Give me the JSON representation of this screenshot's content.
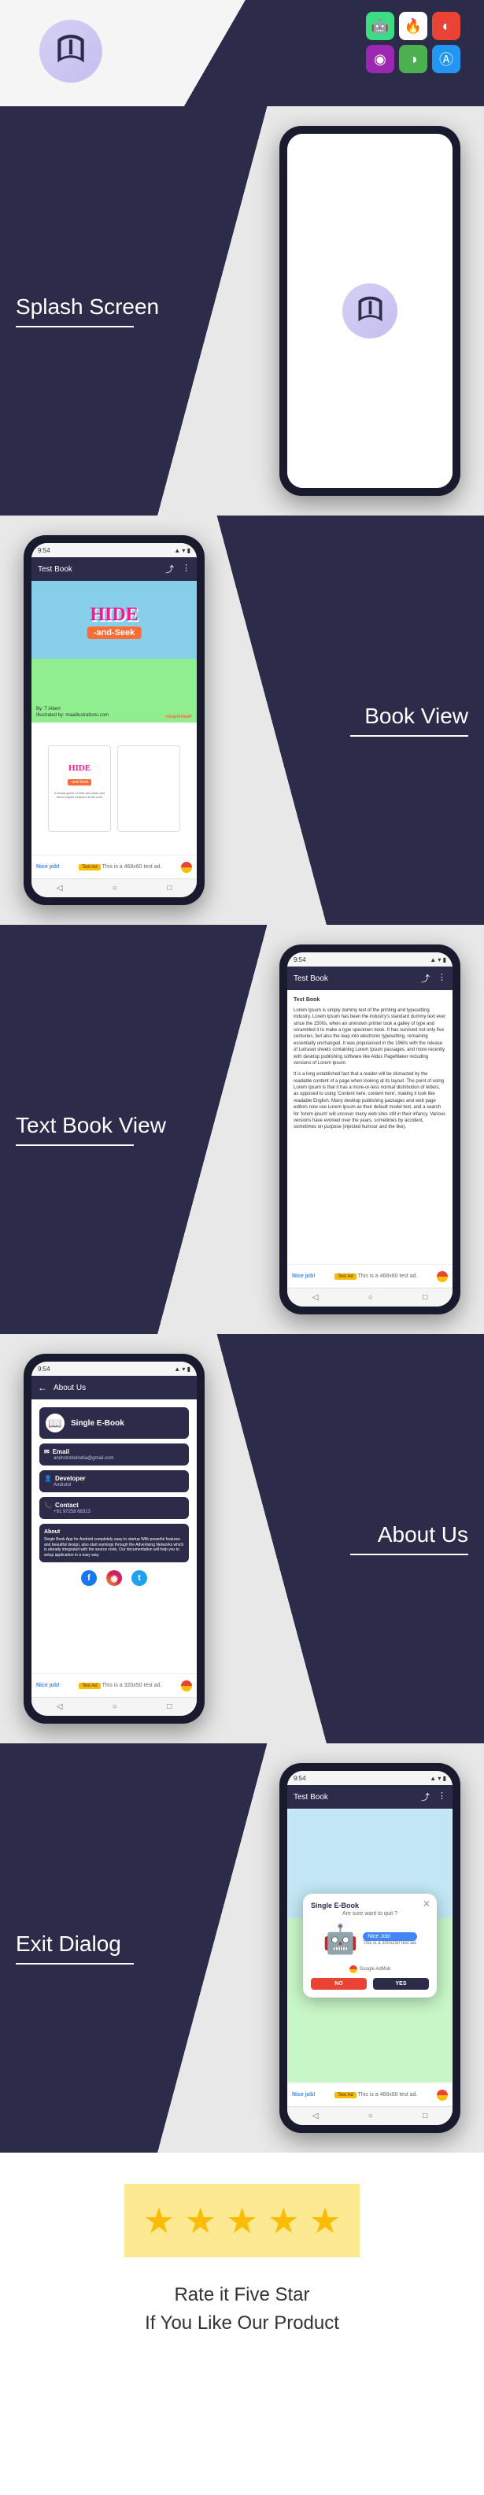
{
  "header": {
    "icons": [
      "android-studio",
      "firebase",
      "admob",
      "unity",
      "playstore",
      "appstore"
    ]
  },
  "sections": {
    "splash": {
      "label": "Splash Screen"
    },
    "bookview": {
      "label": "Book View"
    },
    "textbook": {
      "label": "Text Book View"
    },
    "about": {
      "label": "About Us"
    },
    "exit": {
      "label": "Exit Dialog"
    }
  },
  "phone": {
    "status_time": "9:54",
    "status_icons": "▲ ▾ ▮",
    "app_title": "Test Book",
    "about_title": "About Us",
    "nav": {
      "back": "◁",
      "home": "○",
      "recent": "□"
    }
  },
  "book": {
    "title": "HIDE",
    "subtitle": "-and-Seek",
    "author_line1": "By: T Albert",
    "author_line2": "Illustrated by: maaillustrations.com",
    "badge": "•maple•leaf•",
    "mini_text": "A virtual game of hide-and-seek and there maybe treasure at the end!"
  },
  "textbook": {
    "heading": "Test Book",
    "p1": "Lorem Ipsum is simply dummy text of the printing and typesetting industry. Lorem Ipsum has been the industry's standard dummy text ever since the 1500s, when an unknown printer took a galley of type and scrambled it to make a type specimen book. It has survived not only five centuries, but also the leap into electronic typesetting, remaining essentially unchanged. It was popularised in the 1960s with the release of Letraset sheets containing Lorem Ipsum passages, and more recently with desktop publishing software like Aldus PageMaker including versions of Lorem Ipsum.",
    "p2": "It is a long established fact that a reader will be distracted by the readable content of a page when looking at its layout. The point of using Lorem Ipsum is that it has a more-or-less normal distribution of letters, as opposed to using 'Content here, content here', making it look like readable English. Many desktop publishing packages and web page editors now use Lorem Ipsum as their default model text, and a search for 'lorem ipsum' will uncover many web sites still in their infancy. Various versions have evolved over the years, sometimes by accident, sometimes on purpose (injected humour and the like)."
  },
  "about": {
    "brand": "Single E-Book",
    "email_label": "Email",
    "email_value": "androtrebolindia@gmail.com",
    "developer_label": "Developer",
    "developer_value": "Androtol",
    "contact_label": "Contact",
    "contact_value": "+91 97258 68313",
    "about_label": "About",
    "about_text": "Single Book App for Android completely easy to startup With powerful features and beautiful design, also start earnings through the Advertising Networks which is already integrated with the source code, Our documentation will help you to setup application in a easy way."
  },
  "exit": {
    "title": "Single E-Book",
    "subtitle": "Are sure want to quit ?",
    "nice": "Nice Job!",
    "ad_text": "This is a 300x250 test ad.",
    "admob": "Google AdMob",
    "no": "NO",
    "yes": "YES"
  },
  "ads": {
    "test_label": "Test Ad",
    "nice_job": "Nice job!",
    "banner_468": "This is a 468x60 test ad.",
    "banner_320": "This is a 320x50 test ad."
  },
  "rating": {
    "line1": "Rate it Five Star",
    "line2": "If You Like Our Product"
  }
}
